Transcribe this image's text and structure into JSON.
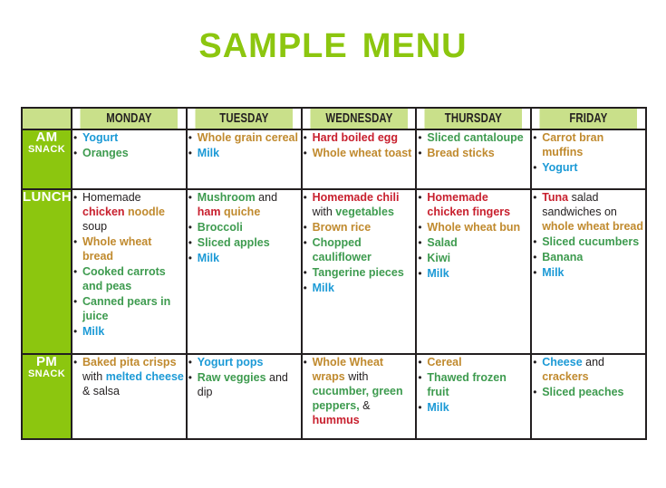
{
  "title": "Sample Menu",
  "colors": {
    "title_green": "#8CC60F",
    "header_bg": "#C9E08A",
    "rowlabel_bg": "#8CC60F",
    "border": "#231f20",
    "vegetable_green": "#3E9B4F",
    "dairy_blue": "#1C9AD6",
    "protein_red": "#C8202E",
    "grain_brown": "#C08A2E",
    "plain_black": "#231f20"
  },
  "table": {
    "corner_label": "",
    "day_headers": [
      "MONDAY",
      "TUESDAY",
      "WEDNESDAY",
      "THURSDAY",
      "FRIDAY"
    ],
    "rows": [
      {
        "label_line1": "AM",
        "label_line2": "SNACK",
        "cells": [
          {
            "day": "MONDAY",
            "items": [
              [
                {
                  "t": "Yogurt",
                  "c": "b"
                }
              ],
              [
                {
                  "t": "Oranges",
                  "c": "g"
                }
              ]
            ]
          },
          {
            "day": "TUESDAY",
            "items": [
              [
                {
                  "t": "Whole grain cereal",
                  "c": "n"
                }
              ],
              [
                {
                  "t": "Milk",
                  "c": "b"
                }
              ]
            ]
          },
          {
            "day": "WEDNESDAY",
            "items": [
              [
                {
                  "t": "Hard boiled egg",
                  "c": "r"
                }
              ],
              [
                {
                  "t": "Whole wheat toast",
                  "c": "n"
                }
              ]
            ]
          },
          {
            "day": "THURSDAY",
            "items": [
              [
                {
                  "t": "Sliced cantaloupe",
                  "c": "g"
                }
              ],
              [
                {
                  "t": "Bread sticks",
                  "c": "n"
                }
              ]
            ]
          },
          {
            "day": "FRIDAY",
            "items": [
              [
                {
                  "t": "Carrot bran muffins",
                  "c": "n"
                }
              ],
              [
                {
                  "t": "Yogurt",
                  "c": "b"
                }
              ]
            ]
          }
        ]
      },
      {
        "label_line1": "LUNCH",
        "label_line2": "",
        "cells": [
          {
            "day": "MONDAY",
            "items": [
              [
                {
                  "t": "Homemade ",
                  "c": "k"
                },
                {
                  "t": "chicken",
                  "c": "r"
                },
                {
                  "t": " ",
                  "c": "k"
                },
                {
                  "t": "noodle",
                  "c": "n"
                },
                {
                  "t": " soup",
                  "c": "k"
                }
              ],
              [
                {
                  "t": "Whole wheat bread",
                  "c": "n"
                }
              ],
              [
                {
                  "t": "Cooked carrots and peas",
                  "c": "g"
                }
              ],
              [
                {
                  "t": "Canned pears in juice",
                  "c": "g"
                }
              ],
              [
                {
                  "t": "Milk",
                  "c": "b"
                }
              ]
            ]
          },
          {
            "day": "TUESDAY",
            "items": [
              [
                {
                  "t": "Mushroom",
                  "c": "g"
                },
                {
                  "t": " and ",
                  "c": "k"
                },
                {
                  "t": "ham",
                  "c": "r"
                },
                {
                  "t": " ",
                  "c": "k"
                },
                {
                  "t": "quiche",
                  "c": "n"
                }
              ],
              [
                {
                  "t": "Broccoli",
                  "c": "g"
                }
              ],
              [
                {
                  "t": "Sliced apples",
                  "c": "g"
                }
              ],
              [
                {
                  "t": "Milk",
                  "c": "b"
                }
              ]
            ]
          },
          {
            "day": "WEDNESDAY",
            "items": [
              [
                {
                  "t": "Homemade chili",
                  "c": "r"
                },
                {
                  "t": " with ",
                  "c": "k"
                },
                {
                  "t": "vegetables",
                  "c": "g"
                }
              ],
              [
                {
                  "t": "Brown rice",
                  "c": "n"
                }
              ],
              [
                {
                  "t": "Chopped cauliflower",
                  "c": "g"
                }
              ],
              [
                {
                  "t": "Tangerine pieces",
                  "c": "g"
                }
              ],
              [
                {
                  "t": "Milk",
                  "c": "b"
                }
              ]
            ]
          },
          {
            "day": "THURSDAY",
            "items": [
              [
                {
                  "t": "Homemade chicken fingers",
                  "c": "r"
                }
              ],
              [
                {
                  "t": "Whole wheat bun",
                  "c": "n"
                }
              ],
              [
                {
                  "t": "Salad",
                  "c": "g"
                }
              ],
              [
                {
                  "t": "Kiwi",
                  "c": "g"
                }
              ],
              [
                {
                  "t": "Milk",
                  "c": "b"
                }
              ]
            ]
          },
          {
            "day": "FRIDAY",
            "items": [
              [
                {
                  "t": "Tuna",
                  "c": "r"
                },
                {
                  "t": " salad sandwiches on ",
                  "c": "k"
                },
                {
                  "t": "whole wheat bread",
                  "c": "n"
                }
              ],
              [
                {
                  "t": "Sliced cucumbers",
                  "c": "g"
                }
              ],
              [
                {
                  "t": "Banana",
                  "c": "g"
                }
              ],
              [
                {
                  "t": "Milk",
                  "c": "b"
                }
              ]
            ]
          }
        ]
      },
      {
        "label_line1": "PM",
        "label_line2": "SNACK",
        "cells": [
          {
            "day": "MONDAY",
            "items": [
              [
                {
                  "t": "Baked pita crisps",
                  "c": "n"
                },
                {
                  "t": " with ",
                  "c": "k"
                },
                {
                  "t": "melted cheese",
                  "c": "b"
                },
                {
                  "t": " & salsa",
                  "c": "k"
                }
              ]
            ]
          },
          {
            "day": "TUESDAY",
            "items": [
              [
                {
                  "t": "Yogurt pops",
                  "c": "b"
                }
              ],
              [
                {
                  "t": "Raw veggies",
                  "c": "g"
                },
                {
                  "t": " and dip",
                  "c": "k"
                }
              ]
            ]
          },
          {
            "day": "WEDNESDAY",
            "items": [
              [
                {
                  "t": "Whole Wheat wraps",
                  "c": "n"
                },
                {
                  "t": " with ",
                  "c": "k"
                },
                {
                  "t": "cucumber, green peppers,",
                  "c": "g"
                },
                {
                  "t": " & ",
                  "c": "k"
                },
                {
                  "t": "hummus",
                  "c": "r"
                }
              ]
            ]
          },
          {
            "day": "THURSDAY",
            "items": [
              [
                {
                  "t": "Cereal",
                  "c": "n"
                }
              ],
              [
                {
                  "t": "Thawed frozen fruit",
                  "c": "g"
                }
              ],
              [
                {
                  "t": "Milk",
                  "c": "b"
                }
              ]
            ]
          },
          {
            "day": "FRIDAY",
            "items": [
              [
                {
                  "t": "Cheese",
                  "c": "b"
                },
                {
                  "t": " and ",
                  "c": "k"
                },
                {
                  "t": "crackers",
                  "c": "n"
                }
              ],
              [
                {
                  "t": "Sliced peaches",
                  "c": "g"
                }
              ]
            ]
          }
        ]
      }
    ]
  }
}
